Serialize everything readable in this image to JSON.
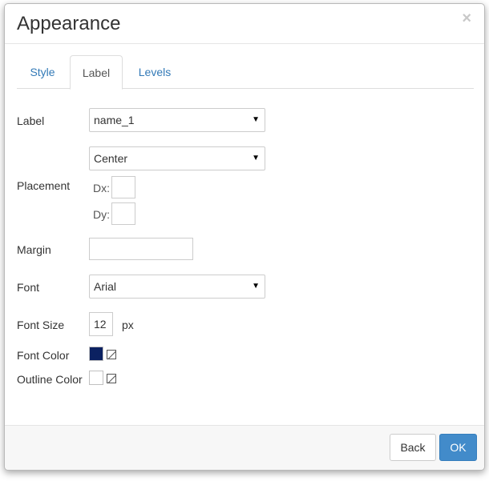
{
  "dialog": {
    "title": "Appearance",
    "close": "×"
  },
  "tabs": [
    {
      "label": "Style",
      "active": false
    },
    {
      "label": "Label",
      "active": true
    },
    {
      "label": "Levels",
      "active": false
    }
  ],
  "form": {
    "label": {
      "label": "Label",
      "value": "name_1"
    },
    "placement": {
      "label": "Placement",
      "value": "Center",
      "dx_label": "Dx:",
      "dx_value": "",
      "dy_label": "Dy:",
      "dy_value": ""
    },
    "margin": {
      "label": "Margin",
      "value": ""
    },
    "font": {
      "label": "Font",
      "value": "Arial"
    },
    "font_size": {
      "label": "Font Size",
      "value": "12",
      "unit": "px"
    },
    "font_color": {
      "label": "Font Color",
      "color": "#0b2161"
    },
    "outline_color": {
      "label": "Outline Color",
      "color": "#ffffff"
    }
  },
  "footer": {
    "back_label": "Back",
    "ok_label": "OK"
  },
  "icons": {
    "dropdown": "▼"
  }
}
